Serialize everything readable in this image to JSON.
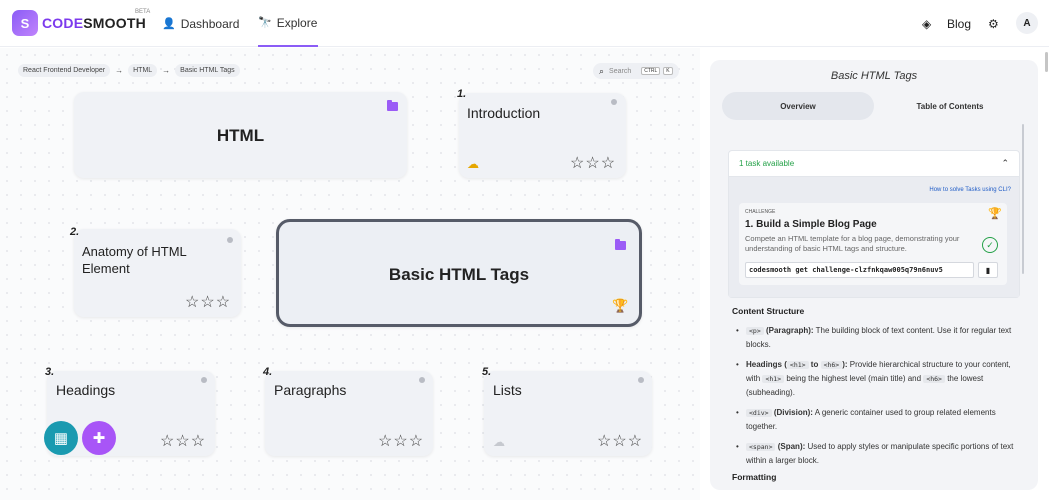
{
  "app": {
    "logo_letter": "S",
    "brand_code": "CODE",
    "brand_rest": "SMOOTH",
    "beta": "BETA"
  },
  "nav": {
    "dashboard": "Dashboard",
    "explore": "Explore",
    "blog": "Blog",
    "avatar": "A"
  },
  "breadcrumb": [
    "React Frontend Developer",
    "HTML",
    "Basic HTML Tags"
  ],
  "search": {
    "placeholder": "Search",
    "kbd1": "CTRL",
    "kbd2": "K"
  },
  "cards": {
    "html": {
      "title": "HTML"
    },
    "intro": {
      "num": "1.",
      "title": "Introduction"
    },
    "anatomy": {
      "num": "2.",
      "title": "Anatomy of HTML Element"
    },
    "basic": {
      "title": "Basic HTML Tags"
    },
    "headings": {
      "num": "3.",
      "title": "Headings"
    },
    "paragraphs": {
      "num": "4.",
      "title": "Paragraphs"
    },
    "lists": {
      "num": "5.",
      "title": "Lists"
    }
  },
  "stars": "☆☆☆",
  "panel": {
    "title": "Basic HTML Tags",
    "tabs": [
      "Overview",
      "Table of Contents"
    ],
    "task_available": "1 task available",
    "howto": "How to solve Tasks using CLI?",
    "challenge_label": "CHALLENGE",
    "challenge_title": "1. Build a Simple Blog Page",
    "challenge_desc": "Compete an HTML template for a blog page, demonstrating your understanding of basic HTML tags and structure.",
    "command": "codesmooth get challenge-clzfnkqaw005q79n6nuv5",
    "content_heading": "Content Structure",
    "items": [
      {
        "tag": "<p>",
        "bold": "(Paragraph):",
        "text": " The building block of text content. Use it for regular text blocks."
      },
      {
        "bold_pre": "Headings (",
        "tag1": "<h1>",
        "mid": " to ",
        "tag2": "<h6>",
        "bold": "):",
        "text1": " Provide hierarchical structure to your content, with ",
        "tag3": "<h1>",
        "text2": " being the highest level (main title) and ",
        "tag4": "<h6>",
        "text3": " the lowest (subheading)."
      },
      {
        "tag": "<div>",
        "bold": "(Division):",
        "text": " A generic container used to group related elements together."
      },
      {
        "tag": "<span>",
        "bold": "(Span):",
        "text": " Used to apply styles or manipulate specific portions of text within a larger block."
      }
    ],
    "formatting_heading": "Formatting"
  }
}
